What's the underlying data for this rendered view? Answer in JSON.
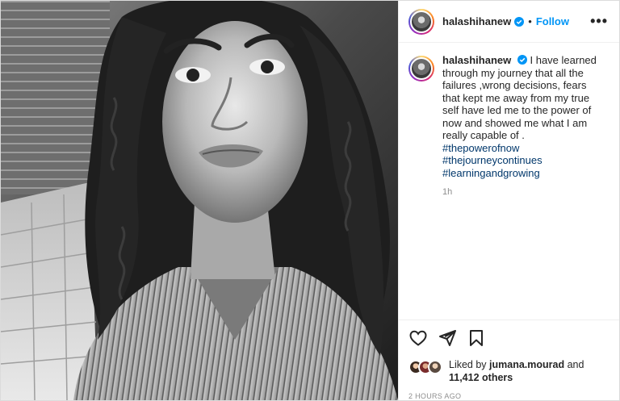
{
  "post": {
    "username": "halashihanew",
    "follow_label": "Follow",
    "separator": "•",
    "more_label": "•••",
    "caption": {
      "username": "halashihanew",
      "text": "I have learned through my journey that all the failures ,wrong decisions, fears that kept me away from my true self have led me to the power of now and showed me what I am really capable of .",
      "hashtags": [
        "#thepowerofnow",
        "#thejourneycontinues",
        "#learningandgrowing"
      ],
      "age": "1h"
    },
    "likes": {
      "prefix": "Liked by ",
      "user": "jumana.mourad",
      "middle": " and",
      "count_label": "11,412 others"
    },
    "posted_time": "2 HOURS AGO"
  },
  "colors": {
    "link": "#0095f6",
    "hashtag": "#00376b",
    "muted": "#8e8e8e",
    "text": "#262626"
  },
  "icons": [
    "verified-badge-icon",
    "more-options-icon",
    "heart-icon",
    "share-icon",
    "bookmark-icon"
  ]
}
